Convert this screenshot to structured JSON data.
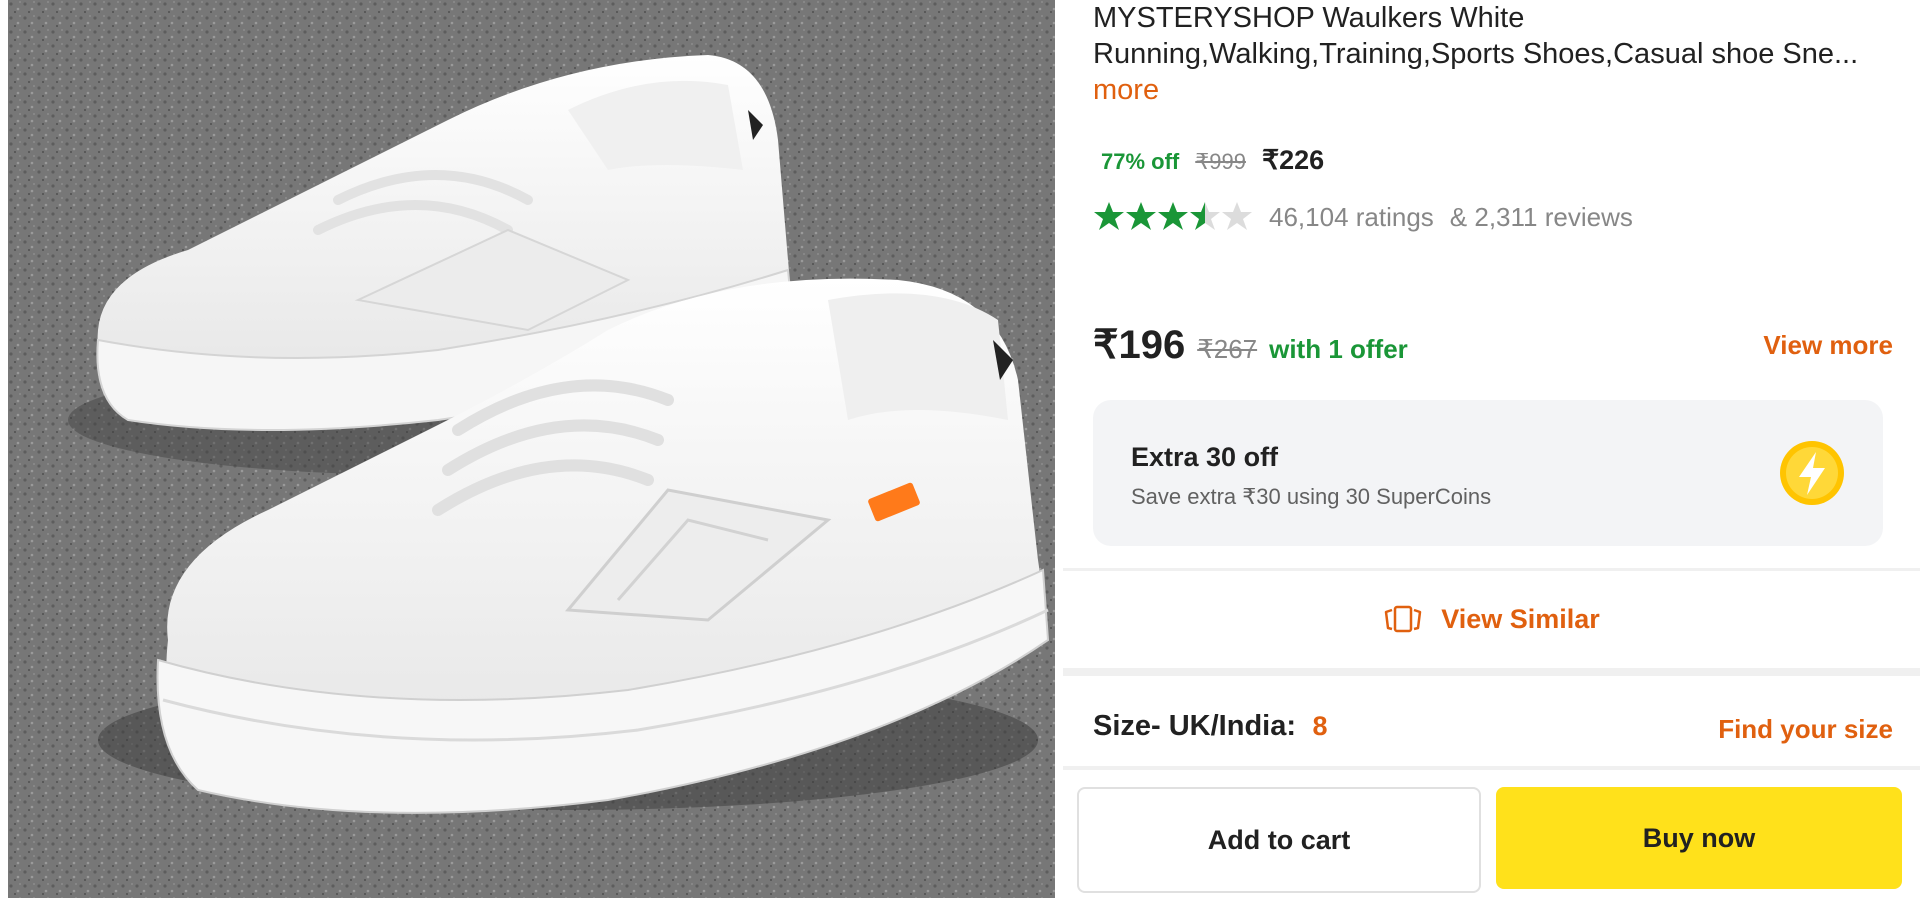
{
  "product": {
    "title": "MYSTERYSHOP Waulkers White Running,Walking,Training,Sports Shoes,Casual shoe Sne...",
    "more_label": "more",
    "discount": "77% off",
    "mrp": "₹999",
    "price": "₹226",
    "rating_stars": 3.5,
    "ratings_count": "46,104 ratings",
    "reviews_count": "& 2,311 reviews"
  },
  "offer": {
    "price": "₹196",
    "mrp": "₹267",
    "with_text": "with 1 offer",
    "view_more_label": "View more"
  },
  "supercoins": {
    "title": "Extra 30 off",
    "subtitle": "Save extra ₹30 using 30 SuperCoins",
    "icon": "lightning-bolt-icon"
  },
  "view_similar": {
    "label": "View Similar",
    "icon": "view-similar-icon"
  },
  "size": {
    "label": "Size- UK/India:",
    "value": "8",
    "find_label": "Find your size"
  },
  "actions": {
    "add_to_cart": "Add to cart",
    "buy_now": "Buy now"
  },
  "colors": {
    "accent_orange": "#e0600f",
    "discount_green": "#1a9637",
    "buy_yellow": "#ffe11b",
    "coin_yellow": "#ffc400"
  }
}
